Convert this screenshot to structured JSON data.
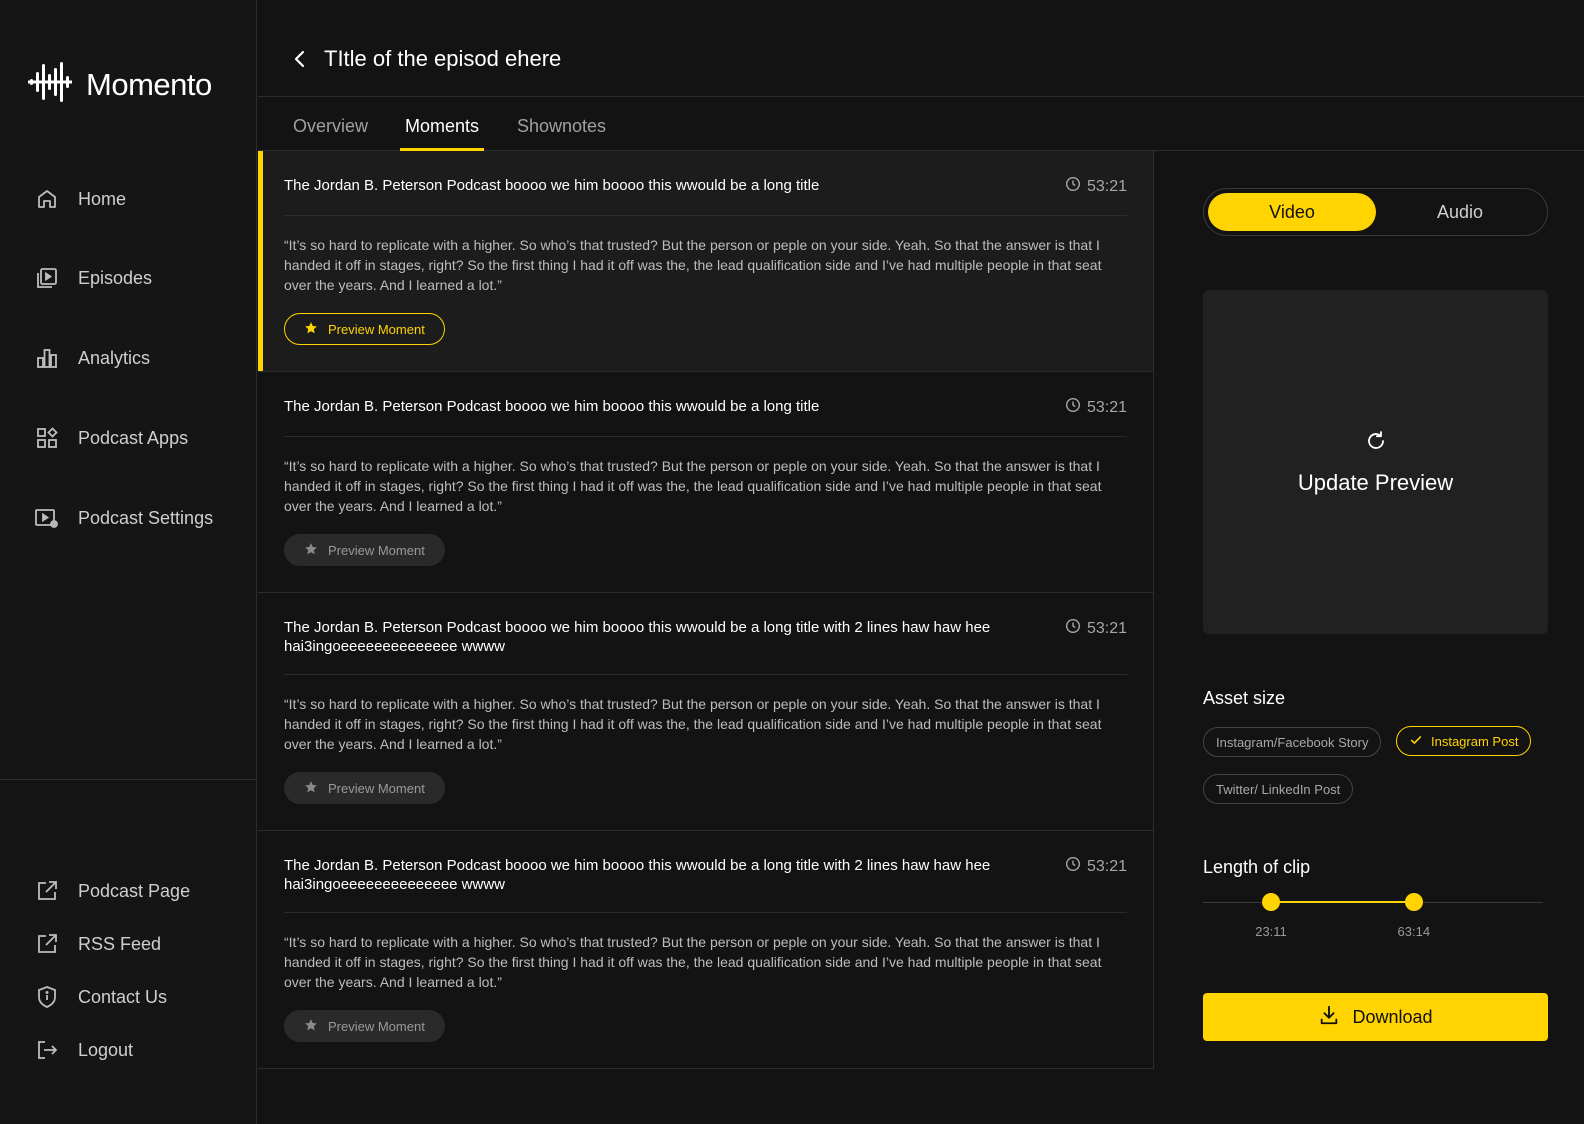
{
  "app": {
    "name": "Momento"
  },
  "sidebar": {
    "main_items": [
      {
        "label": "Home",
        "icon": "home-icon"
      },
      {
        "label": "Episodes",
        "icon": "episodes-icon"
      },
      {
        "label": "Analytics",
        "icon": "analytics-icon"
      },
      {
        "label": "Podcast Apps",
        "icon": "apps-icon"
      },
      {
        "label": "Podcast Settings",
        "icon": "settings-icon"
      }
    ],
    "bottom_items": [
      {
        "label": "Podcast Page",
        "icon": "external-link-icon"
      },
      {
        "label": "RSS Feed",
        "icon": "external-link-icon"
      },
      {
        "label": "Contact Us",
        "icon": "shield-icon"
      },
      {
        "label": "Logout",
        "icon": "logout-icon"
      }
    ]
  },
  "header": {
    "title": "TItle of the episod ehere"
  },
  "tabs": {
    "overview": "Overview",
    "moments": "Moments",
    "shownotes": "Shownotes",
    "active": "Moments"
  },
  "moments": [
    {
      "title": "The Jordan B. Peterson Podcast boooo we  him boooo this wwould be a long title",
      "time": "53:21",
      "quote": "“It’s so hard to replicate with a higher. So who’s that trusted? But the person or peple on your side. Yeah. So that the answer is that I handed it off in stages, right? So the first thing I had it off was the, the lead qualification side and I’ve had multiple people in that seat over the years. And I learned a lot.”",
      "button": "Preview Moment"
    },
    {
      "title": "The Jordan B. Peterson Podcast boooo we  him boooo this wwould be a long title",
      "time": "53:21",
      "quote": "“It’s so hard to replicate with a higher. So who’s that trusted? But the person or peple on your side. Yeah. So that the answer is that I handed it off in stages, right? So the first thing I had it off was the, the lead qualification side and I’ve had multiple people in that seat over the years. And I learned a lot.”",
      "button": "Preview Moment"
    },
    {
      "title": "The Jordan B. Peterson Podcast boooo we  him boooo this wwould be a long title with 2 lines haw haw hee hai3ingoeeeeeeeeeeeeee wwww",
      "time": "53:21",
      "quote": "“It’s so hard to replicate with a higher. So who’s that trusted? But the person or peple on your side. Yeah. So that the answer is that I handed it off in stages, right? So the first thing I had it off was the, the lead qualification side and I’ve had multiple people in that seat over the years. And I learned a lot.”",
      "button": "Preview Moment"
    },
    {
      "title": "The Jordan B. Peterson Podcast boooo we  him boooo this wwould be a long title with 2 lines haw haw hee hai3ingoeeeeeeeeeeeeee wwww",
      "time": "53:21",
      "quote": "“It’s so hard to replicate with a higher. So who’s that trusted? But the person or peple on your side. Yeah. So that the answer is that I handed it off in stages, right? So the first thing I had it off was the, the lead qualification side and I’ve had multiple people in that seat over the years. And I learned a lot.”",
      "button": "Preview Moment"
    }
  ],
  "panel": {
    "toggle": {
      "video": "Video",
      "audio": "Audio",
      "selected": "Video"
    },
    "preview_label": "Update Preview",
    "asset_size": {
      "label": "Asset size",
      "options": [
        "Instagram/Facebook Story",
        "Instagram Post",
        "Twitter/ LinkedIn Post"
      ],
      "selected": "Instagram Post"
    },
    "clip": {
      "label": "Length of clip",
      "start_label": "23:11",
      "end_label": "63:14",
      "start_fraction": 0.2,
      "end_fraction": 0.62
    },
    "download_label": "Download"
  },
  "colors": {
    "accent": "#ffd400",
    "background": "#131313",
    "surface": "#212121"
  }
}
